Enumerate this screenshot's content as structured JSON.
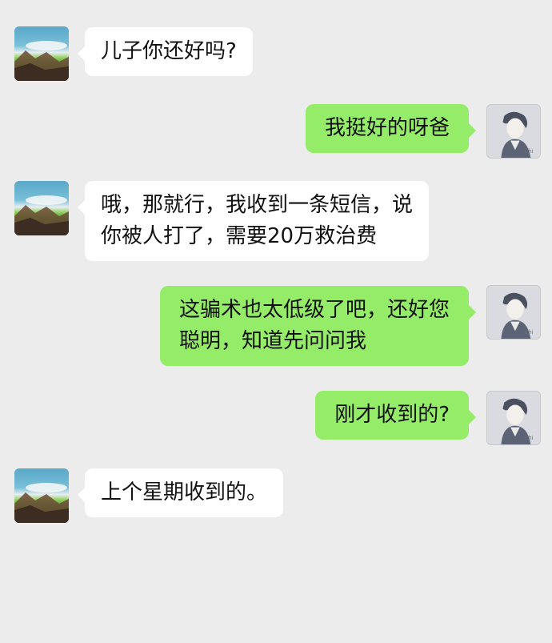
{
  "chat": {
    "messages": [
      {
        "sender": "father",
        "lines": [
          "儿子你还好吗?"
        ]
      },
      {
        "sender": "son",
        "lines": [
          "我挺好的呀爸"
        ]
      },
      {
        "sender": "father",
        "lines": [
          "哦，那就行，我收到一条短信，说",
          "你被人打了，需要20万救治费"
        ]
      },
      {
        "sender": "son",
        "lines": [
          "这骗术也太低级了吧，还好您",
          "聪明，知道先问问我"
        ]
      },
      {
        "sender": "son",
        "lines": [
          "刚才收到的?"
        ]
      },
      {
        "sender": "father",
        "lines": [
          "上个星期收到的。"
        ]
      }
    ]
  },
  "colors": {
    "background": "#ececec",
    "incoming_bubble": "#ffffff",
    "outgoing_bubble": "#95ec69"
  },
  "icons": {
    "father_avatar": "landscape-avatar-icon",
    "son_avatar": "anime-boy-avatar-icon"
  }
}
